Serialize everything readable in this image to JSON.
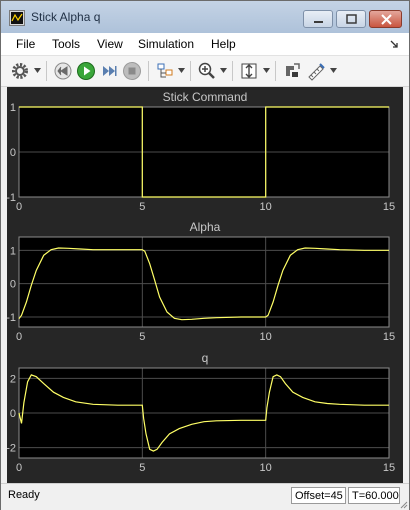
{
  "window": {
    "title": "Stick Alpha q"
  },
  "menu": {
    "file": "File",
    "tools": "Tools",
    "view": "View",
    "simulation": "Simulation",
    "help": "Help"
  },
  "toolbar": {
    "icons": [
      "gear-icon",
      "step-back-icon",
      "run-icon",
      "step-forward-icon",
      "stop-icon",
      "highlight-icon",
      "zoom-in-icon",
      "autoscale-icon",
      "properties-icon",
      "cursor-measure-icon"
    ]
  },
  "colors": {
    "trace": "#ffff66",
    "plot_bg": "#000000",
    "figure_bg": "#262626",
    "grid": "#4d4d4d",
    "text": "#c8c8c8"
  },
  "chart_data": [
    {
      "type": "line",
      "title": "Stick Command",
      "xlim": [
        0,
        15
      ],
      "ylim": [
        -1,
        1
      ],
      "xticks": [
        "0",
        "5",
        "10",
        "15"
      ],
      "yticks": [
        "1",
        "0",
        "-1"
      ],
      "grid": true,
      "series": [
        {
          "x": [
            0,
            5,
            5,
            10,
            10,
            15
          ],
          "y": [
            1,
            1,
            -1,
            -1,
            1,
            1
          ]
        }
      ]
    },
    {
      "type": "line",
      "title": "Alpha",
      "xlim": [
        0,
        15
      ],
      "ylim": [
        -1.3,
        1.4
      ],
      "xticks": [
        "0",
        "5",
        "10",
        "15"
      ],
      "yticks": [
        "1",
        "0",
        "-1"
      ],
      "grid": true,
      "series": [
        {
          "x": [
            0,
            0.1,
            0.3,
            0.5,
            0.7,
            1.0,
            1.3,
            1.6,
            2.0,
            2.5,
            3.0,
            4.0,
            5.0,
            5.1,
            5.3,
            5.5,
            5.7,
            6.0,
            6.3,
            6.6,
            7.0,
            7.5,
            8.0,
            9.0,
            10.0,
            10.1,
            10.3,
            10.5,
            10.7,
            11.0,
            11.3,
            11.6,
            12.0,
            12.5,
            13.0,
            14.0,
            15.0
          ],
          "y": [
            -1.05,
            -0.95,
            -0.55,
            -0.05,
            0.4,
            0.85,
            1.02,
            1.07,
            1.06,
            1.04,
            1.02,
            1.02,
            1.02,
            0.97,
            0.6,
            0.1,
            -0.4,
            -0.85,
            -1.04,
            -1.08,
            -1.07,
            -1.04,
            -1.02,
            -1.0,
            -1.0,
            -0.95,
            -0.55,
            -0.05,
            0.4,
            0.85,
            1.02,
            1.07,
            1.06,
            1.04,
            1.02,
            1.0,
            1.0
          ]
        }
      ]
    },
    {
      "type": "line",
      "title": "q",
      "xlim": [
        0,
        15
      ],
      "ylim": [
        -2.6,
        2.6
      ],
      "xticks": [
        "0",
        "5",
        "10",
        "15"
      ],
      "yticks": [
        "2",
        "0",
        "-2"
      ],
      "grid": true,
      "series": [
        {
          "x": [
            0,
            0.1,
            0.2,
            0.35,
            0.5,
            0.7,
            1.0,
            1.4,
            1.8,
            2.3,
            3.0,
            4.0,
            5.0,
            5.05,
            5.15,
            5.3,
            5.45,
            5.6,
            5.8,
            6.1,
            6.5,
            7.0,
            7.5,
            8.0,
            9.0,
            10.0,
            10.05,
            10.15,
            10.3,
            10.45,
            10.6,
            10.8,
            11.1,
            11.5,
            12.0,
            12.5,
            13.0,
            14.0,
            15.0
          ],
          "y": [
            0,
            -0.6,
            0.6,
            1.8,
            2.2,
            2.1,
            1.7,
            1.2,
            0.9,
            0.65,
            0.5,
            0.45,
            0.45,
            -0.3,
            -1.2,
            -2.1,
            -2.2,
            -2.1,
            -1.7,
            -1.2,
            -0.9,
            -0.65,
            -0.5,
            -0.45,
            -0.42,
            -0.42,
            0.3,
            1.2,
            2.1,
            2.2,
            2.1,
            1.7,
            1.2,
            0.9,
            0.65,
            0.55,
            0.5,
            0.45,
            0.45
          ]
        }
      ]
    }
  ],
  "status": {
    "ready": "Ready",
    "offset": "Offset=45",
    "time": "T=60.000"
  }
}
